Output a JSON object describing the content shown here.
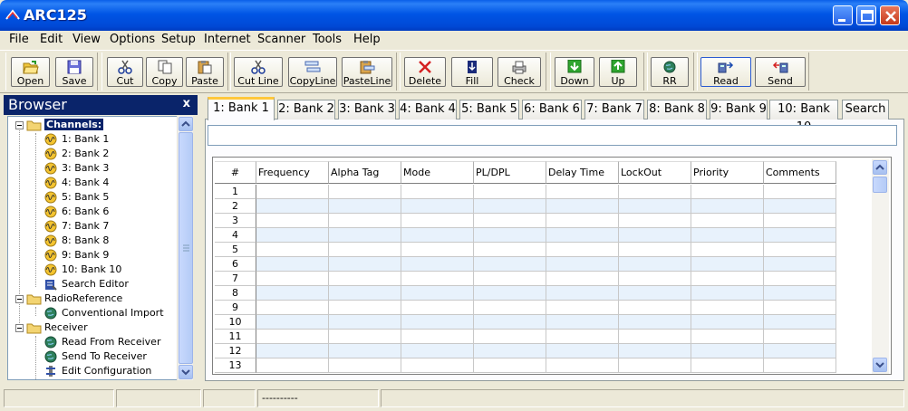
{
  "window": {
    "title": "ARC125",
    "logo_icon": "arc-logo-icon",
    "controls": [
      "minimize",
      "maximize",
      "close"
    ]
  },
  "menu": [
    "File",
    "Edit",
    "View",
    "Options",
    "Setup",
    "Internet",
    "Scanner",
    "Tools",
    "Help"
  ],
  "toolbar": {
    "open": "Open",
    "save": "Save",
    "cut": "Cut",
    "copy": "Copy",
    "paste": "Paste",
    "cut_line": "Cut Line",
    "copy_line": "CopyLine",
    "paste_line": "PasteLine",
    "delete": "Delete",
    "fill": "Fill",
    "check": "Check",
    "down": "Down",
    "up": "Up",
    "rr": "RR",
    "read": "Read",
    "send": "Send"
  },
  "browser": {
    "title": "Browser",
    "close": "x",
    "tree": {
      "channels": "Channels:",
      "banks": [
        "1: Bank 1",
        "2: Bank 2",
        "3: Bank 3",
        "4: Bank 4",
        "5: Bank 5",
        "6: Bank 6",
        "7: Bank 7",
        "8: Bank 8",
        "9: Bank 9",
        "10: Bank 10"
      ],
      "search_editor": "Search Editor",
      "radioreference": "RadioReference",
      "conventional_import": "Conventional Import",
      "receiver": "Receiver",
      "read_from_receiver": "Read From Receiver",
      "send_to_receiver": "Send To Receiver",
      "edit_configuration": "Edit Configuration"
    }
  },
  "tabs": [
    "1: Bank 1",
    "2: Bank 2",
    "3: Bank 3",
    "4: Bank 4",
    "5: Bank 5",
    "6: Bank 6",
    "7: Bank 7",
    "8: Bank 8",
    "9: Bank 9",
    "10: Bank 10",
    "Search"
  ],
  "active_tab": "1: Bank 1",
  "bank_name_value": "",
  "grid": {
    "columns": [
      "#",
      "Frequency",
      "Alpha Tag",
      "Mode",
      "PL/DPL",
      "Delay Time",
      "LockOut",
      "Priority",
      "Comments"
    ],
    "rows": [
      "1",
      "2",
      "3",
      "4",
      "5",
      "6",
      "7",
      "8",
      "9",
      "10",
      "11",
      "12",
      "13"
    ]
  },
  "status": {
    "panel_4": "----------"
  },
  "colors": {
    "title_bar": "#0055e5",
    "browser_header": "#0a246a",
    "selected_tree_item": "#0a246a",
    "grid_alt_row": "#e8f2fc",
    "active_tab_highlight": "#ffc83c"
  }
}
